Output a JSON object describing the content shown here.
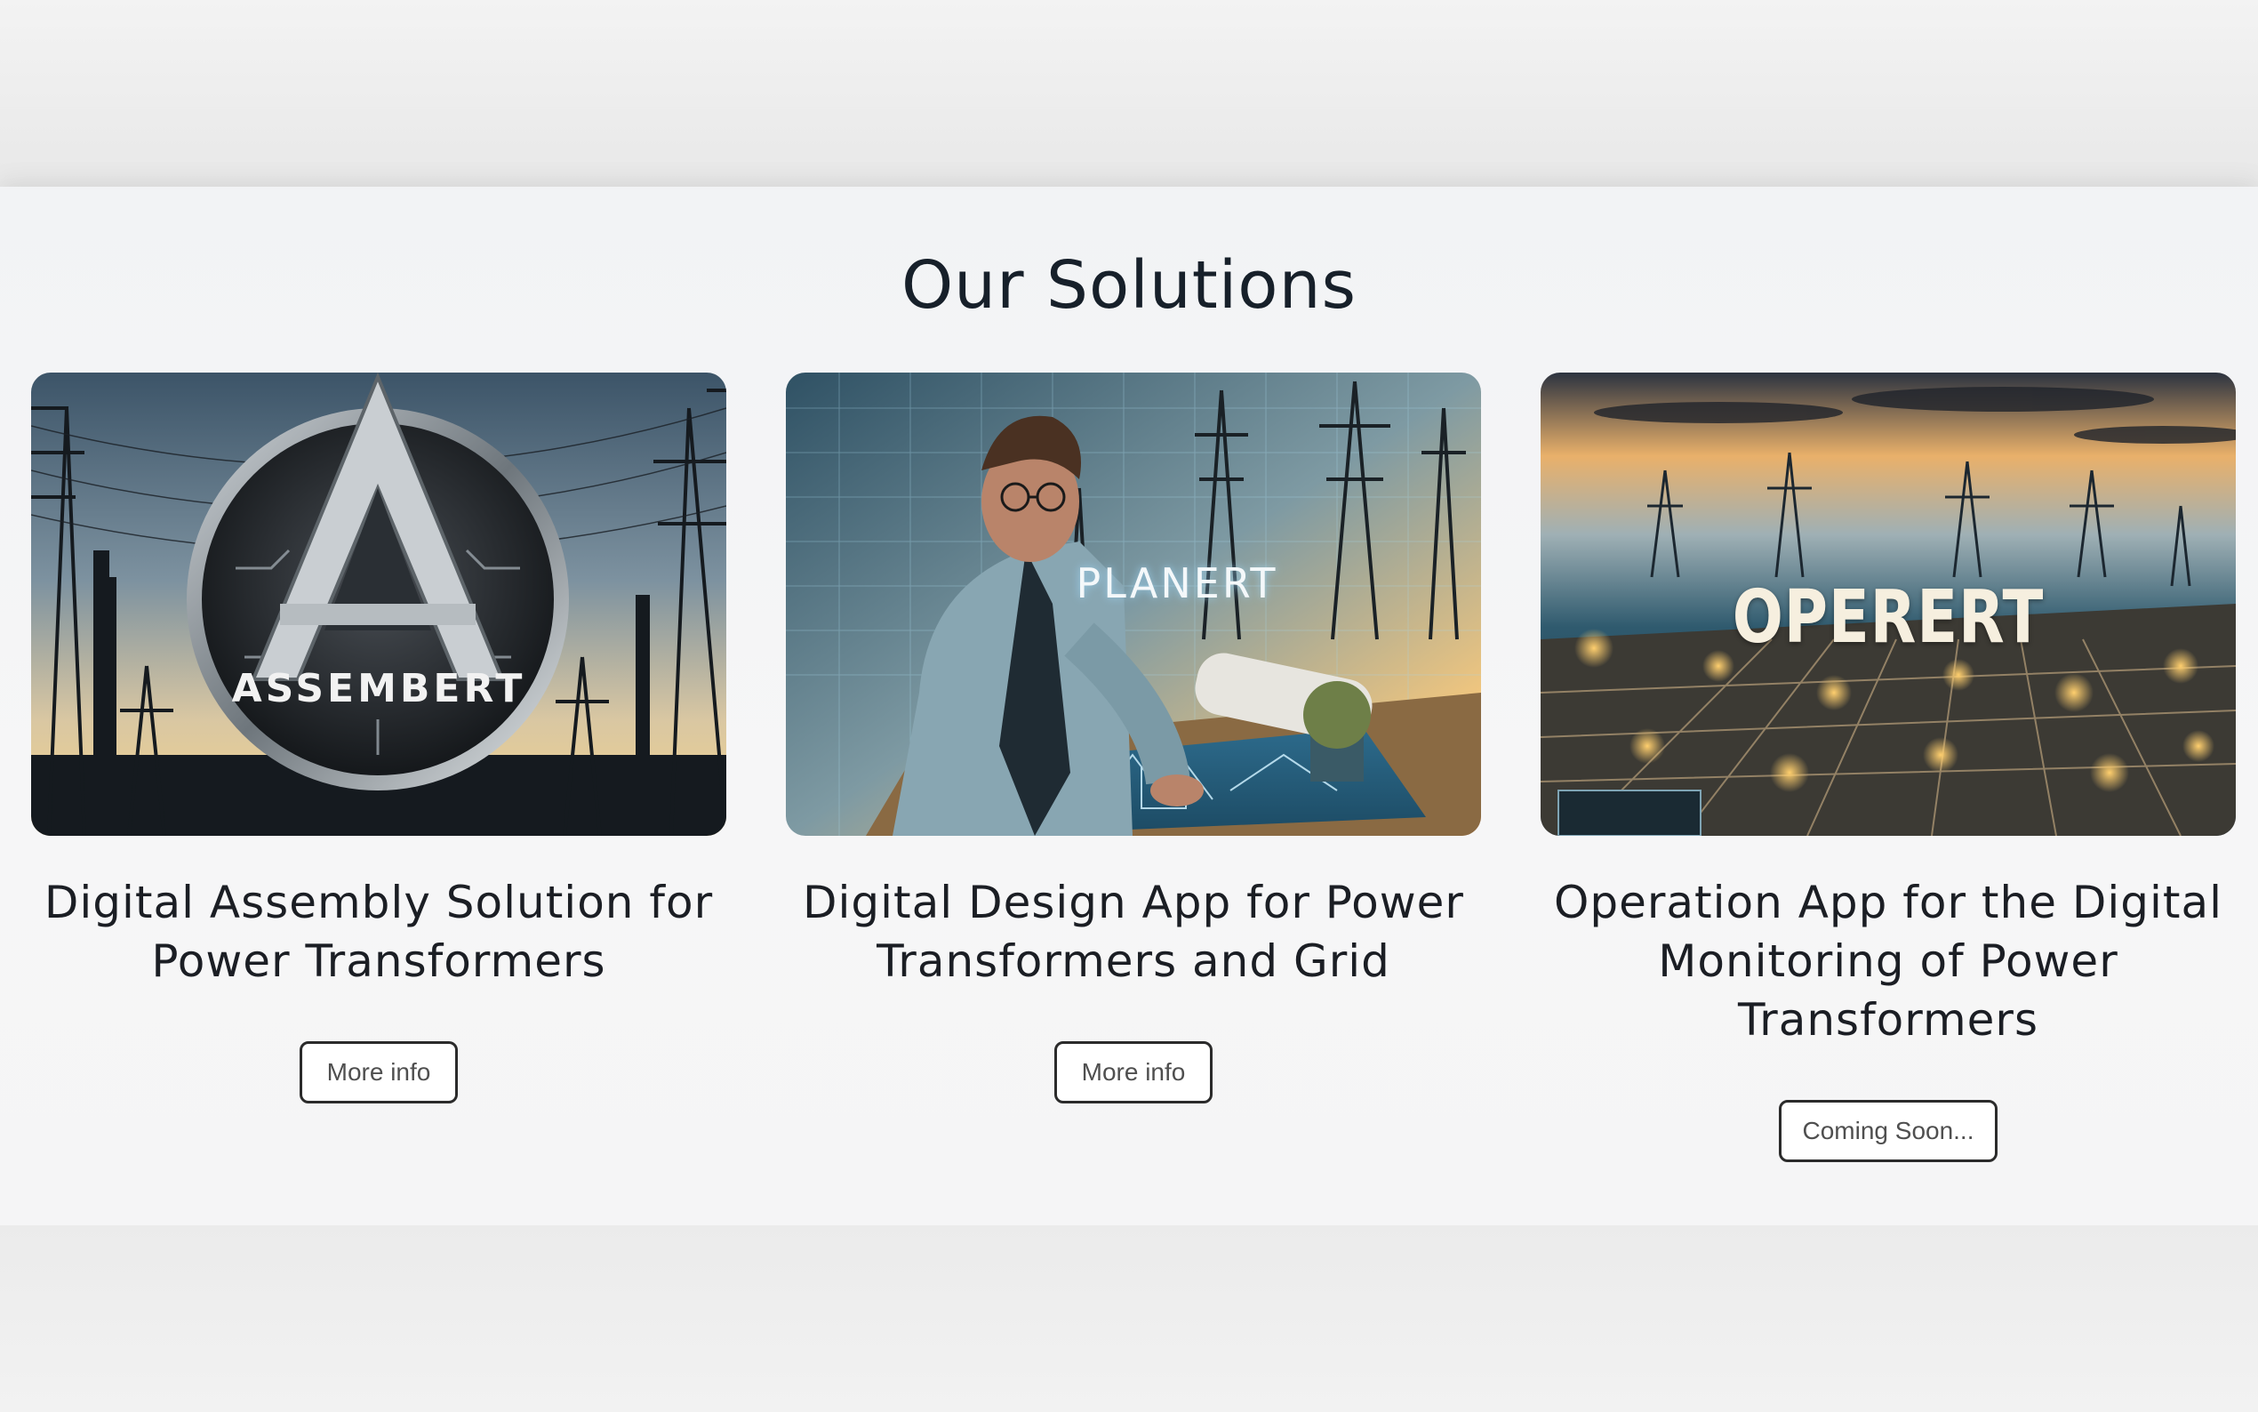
{
  "section": {
    "title": "Our Solutions"
  },
  "cards": [
    {
      "image_text": "ASSEMBERT",
      "title": "Digital Assembly Solution for Power Transformers",
      "button_label": "More info"
    },
    {
      "image_text": "PLANERT",
      "title": "Digital Design App for Power Transformers and Grid",
      "button_label": "More info"
    },
    {
      "image_text": "OPERERT",
      "title": "Operation App for the Digital Monitoring of Power Transformers",
      "button_label": "Coming Soon..."
    }
  ],
  "colors": {
    "title_text": "#17202a",
    "button_border": "#2b2b2b",
    "background": "#f3f4f5"
  }
}
